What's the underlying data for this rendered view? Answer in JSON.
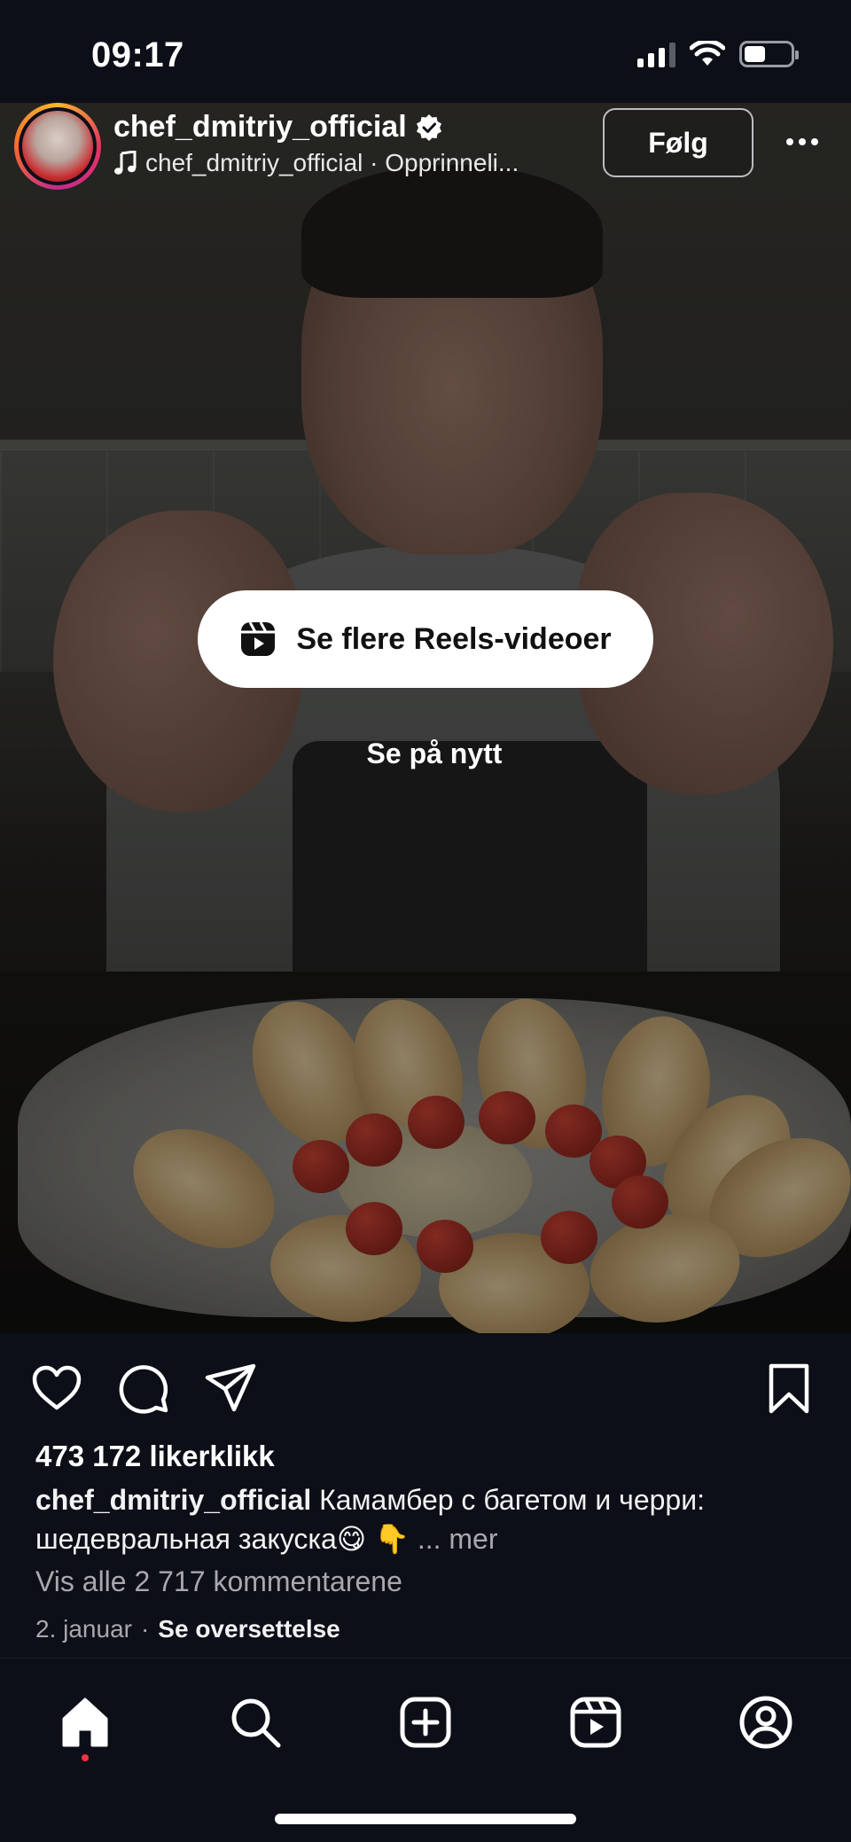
{
  "status_bar": {
    "time": "09:17",
    "signal_level": "3 of 4",
    "battery_level": 0.45
  },
  "post": {
    "username": "chef_dmitriy_official",
    "verified": true,
    "audio_icon": "music-note-icon",
    "audio_text": "chef_dmitriy_official · Opprinneli...",
    "follow_label": "Følg",
    "more_icon": "more-horizontal-icon",
    "overlay": {
      "reels_label": "Se flere Reels-videoer",
      "reels_icon": "reels-icon",
      "replay_label": "Se på nytt"
    },
    "actions": {
      "like_icon": "heart-icon",
      "comment_icon": "comment-icon",
      "share_icon": "send-icon",
      "save_icon": "bookmark-icon"
    },
    "likes_text": "473 172 likerklikk",
    "caption": {
      "username": "chef_dmitriy_official",
      "text": " Камамбер с багетом и черри: шедевральная закуска😋 👇",
      "more": "... mer"
    },
    "comments_text": "Vis alle 2 717 kommentarene",
    "date": "2. januar",
    "separator": "·",
    "translate_label": "Se oversettelse"
  },
  "tabbar": {
    "items": [
      {
        "name": "home",
        "icon": "home-icon",
        "active": true
      },
      {
        "name": "search",
        "icon": "search-icon"
      },
      {
        "name": "create",
        "icon": "plus-square-icon"
      },
      {
        "name": "reels",
        "icon": "reels-icon"
      },
      {
        "name": "profile",
        "icon": "profile-icon"
      }
    ]
  },
  "colors": {
    "background": "#0c0f17",
    "notification_dot": "#ff3040",
    "secondary_text": "#a8a8ad"
  }
}
